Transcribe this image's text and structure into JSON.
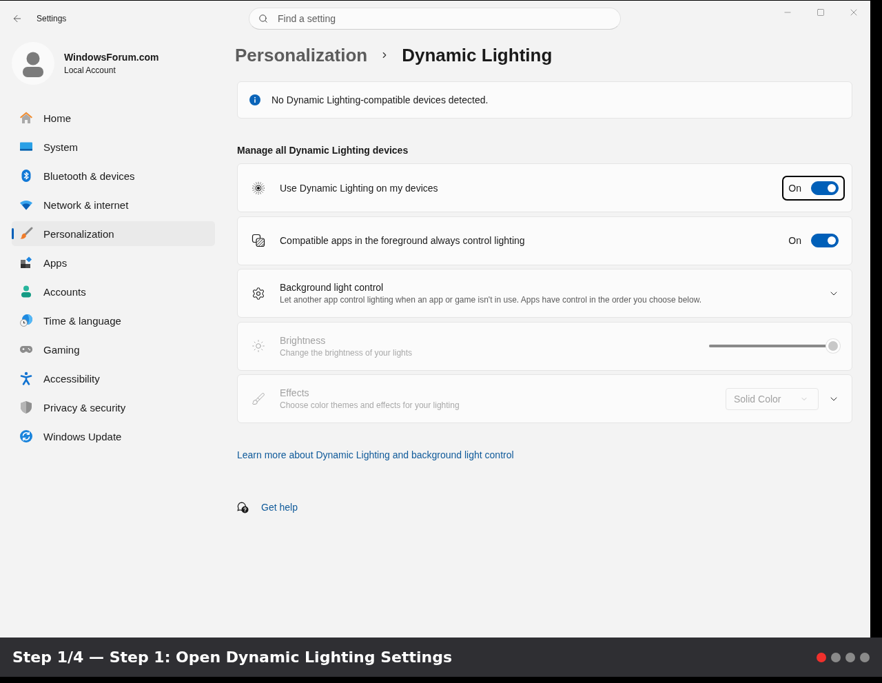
{
  "window": {
    "title": "Settings"
  },
  "search": {
    "placeholder": "Find a setting"
  },
  "profile": {
    "name": "WindowsForum.com",
    "account": "Local Account"
  },
  "sidebar": {
    "items": [
      {
        "label": "Home",
        "selected": false
      },
      {
        "label": "System",
        "selected": false
      },
      {
        "label": "Bluetooth & devices",
        "selected": false
      },
      {
        "label": "Network & internet",
        "selected": false
      },
      {
        "label": "Personalization",
        "selected": true
      },
      {
        "label": "Apps",
        "selected": false
      },
      {
        "label": "Accounts",
        "selected": false
      },
      {
        "label": "Time & language",
        "selected": false
      },
      {
        "label": "Gaming",
        "selected": false
      },
      {
        "label": "Accessibility",
        "selected": false
      },
      {
        "label": "Privacy & security",
        "selected": false
      },
      {
        "label": "Windows Update",
        "selected": false
      }
    ]
  },
  "breadcrumb": {
    "parent": "Personalization",
    "current": "Dynamic Lighting"
  },
  "notice": {
    "text": "No Dynamic Lighting-compatible devices detected."
  },
  "section": {
    "heading": "Manage all Dynamic Lighting devices"
  },
  "settings": [
    {
      "kind": "toggle",
      "title": "Use Dynamic Lighting on my devices",
      "state_label": "On",
      "on": true,
      "focused": true,
      "disabled": false
    },
    {
      "kind": "toggle",
      "title": "Compatible apps in the foreground always control lighting",
      "state_label": "On",
      "on": true,
      "focused": false,
      "disabled": false
    },
    {
      "kind": "expander",
      "title": "Background light control",
      "description": "Let another app control lighting when an app or game isn't in use. Apps have control in the order you choose below.",
      "expanded": false,
      "focused": false,
      "disabled": false
    },
    {
      "kind": "slider",
      "title": "Brightness",
      "description": "Change the brightness of your lights",
      "level": 1,
      "focused": false,
      "disabled": true
    },
    {
      "kind": "dropdown",
      "title": "Effects",
      "description": "Choose color themes and effects for your lighting",
      "value": "Solid Color",
      "expanded": false,
      "focused": false,
      "disabled": true
    }
  ],
  "learn_more_link": "Learn more about Dynamic Lighting and background light control",
  "help": {
    "label": "Get help"
  },
  "tutorial_bar": {
    "caption": "Step 1/4 — Step 1: Open Dynamic Lighting Settings",
    "steps": [
      {
        "selected": true
      },
      {
        "selected": false
      },
      {
        "selected": false
      },
      {
        "selected": false
      }
    ]
  }
}
